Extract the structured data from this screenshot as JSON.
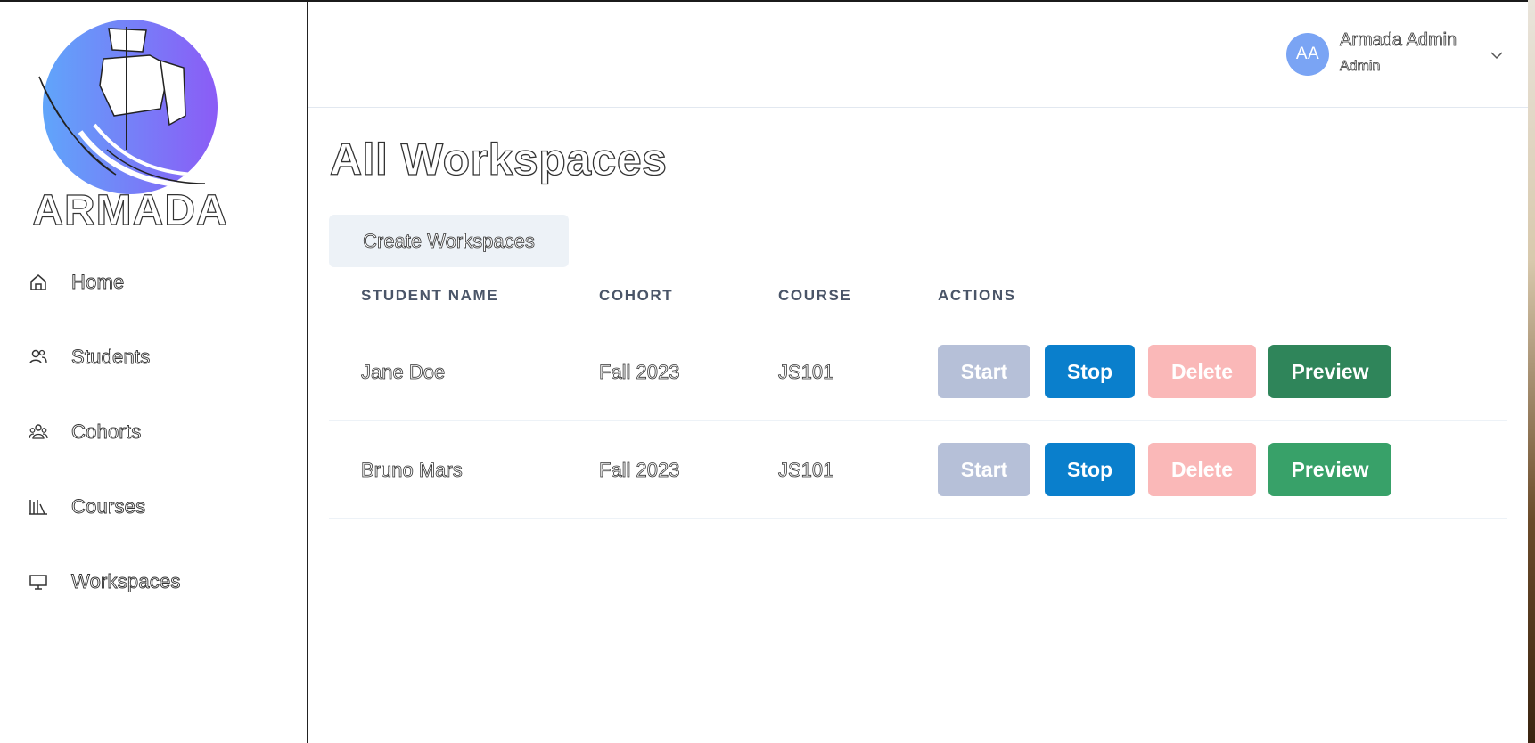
{
  "app": {
    "brand": "ARMADA"
  },
  "sidebar": {
    "items": [
      {
        "label": "Home",
        "icon": "home-icon"
      },
      {
        "label": "Students",
        "icon": "users-icon"
      },
      {
        "label": "Cohorts",
        "icon": "group-icon"
      },
      {
        "label": "Courses",
        "icon": "books-icon"
      },
      {
        "label": "Workspaces",
        "icon": "monitor-icon"
      }
    ]
  },
  "header": {
    "avatar_initials": "AA",
    "user_name": "Armada Admin",
    "user_role": "Admin"
  },
  "main": {
    "title": "All Workspaces",
    "create_button": "Create Workspaces",
    "table": {
      "columns": [
        "STUDENT NAME",
        "COHORT",
        "COURSE",
        "ACTIONS"
      ],
      "rows": [
        {
          "student": "Jane Doe",
          "cohort": "Fall 2023",
          "course": "JS101"
        },
        {
          "student": "Bruno Mars",
          "cohort": "Fall 2023",
          "course": "JS101"
        }
      ],
      "actions": {
        "start": "Start",
        "stop": "Stop",
        "delete": "Delete",
        "preview": "Preview"
      }
    }
  },
  "colors": {
    "start": "#b6c0d8",
    "stop": "#0a7fcc",
    "delete": "#fab8b8",
    "preview": "#2f855a",
    "avatar": "#7aa4f4"
  }
}
